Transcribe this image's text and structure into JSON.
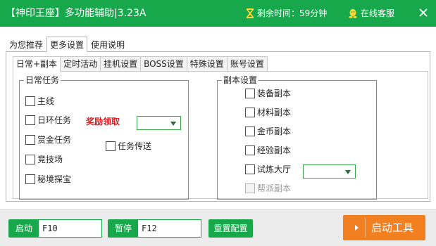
{
  "window": {
    "title": "【神印王座】多功能辅助|3.23A",
    "timer_text": "剩余时间：59分钟",
    "service_text": "在线客服",
    "brand_color": "#18a84c",
    "close_icon": "close-icon"
  },
  "main_tabs": [
    {
      "label": "为您推荐",
      "active": false
    },
    {
      "label": "更多设置",
      "active": true
    },
    {
      "label": "使用说明",
      "active": false
    }
  ],
  "sub_tabs": [
    {
      "label": "日常+副本",
      "active": true
    },
    {
      "label": "定时活动",
      "active": false
    },
    {
      "label": "挂机设置",
      "active": false
    },
    {
      "label": "BOSS设置",
      "active": false
    },
    {
      "label": "特殊设置",
      "active": false
    },
    {
      "label": "账号设置",
      "active": false
    }
  ],
  "daily": {
    "title": "日常任务",
    "main_line": "主线",
    "daily_loop": "日环任务",
    "reward_label": "奖励领取",
    "reward_select": "",
    "bounty": "赏金任务",
    "task_teleport": "任务传送",
    "arena": "竞技场",
    "secret_realm": "秘境探宝"
  },
  "dungeon": {
    "title": "副本设置",
    "equipment": "装备副本",
    "material": "材料副本",
    "gold": "金币副本",
    "experience": "经验副本",
    "trial_hall": "试炼大厅",
    "trial_select": "",
    "guild": "帮派副本"
  },
  "bottom": {
    "start_label": "启动",
    "start_key": "F10",
    "pause_label": "暂停",
    "pause_key": "F12",
    "reset_label": "重置配置",
    "launch_label": "启动工具",
    "launch_color": "#f28020"
  }
}
